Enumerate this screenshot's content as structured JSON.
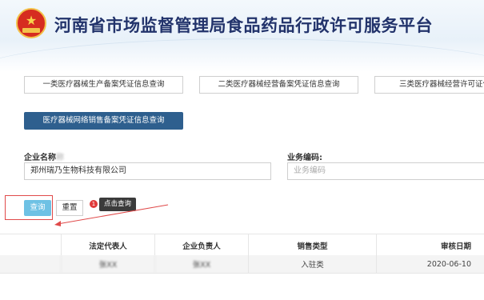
{
  "header": {
    "title": "河南省市场监督管理局食品药品行政许可服务平台",
    "emblem_icon": "national-emblem-icon"
  },
  "nav": {
    "items": [
      "一类医疗器械生产备案凭证信息查询",
      "二类医疗器械经营备案凭证信息查询",
      "三类医疗器械经营许可证信息查询"
    ],
    "active": "医疗器械网络销售备案凭证信息查询"
  },
  "form": {
    "company_name_label": "企业名称",
    "company_name_value": "郑州瑞乃生物科技有限公司",
    "business_code_label": "业务编码:",
    "business_code_placeholder": "业务编码"
  },
  "actions": {
    "query_label": "查询",
    "reset_label": "重置",
    "step_badge": "1",
    "tooltip": "点击查询"
  },
  "table": {
    "headers": [
      "",
      "法定代表人",
      "企业负责人",
      "销售类型",
      "审核日期"
    ],
    "rows": [
      [
        "",
        "张XX",
        "张XX",
        "入驻类",
        "2020-06-10"
      ]
    ]
  },
  "colors": {
    "title": "#22336b",
    "active_nav": "#2e5f8e",
    "query_button": "#6ec1e4",
    "annotation_red": "#e04a4a"
  }
}
